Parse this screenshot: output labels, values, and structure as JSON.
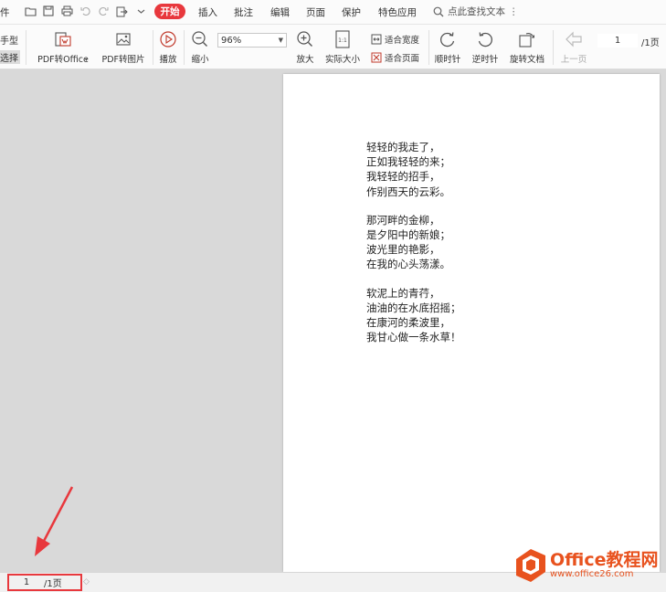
{
  "menubar": {
    "file_label": "件",
    "start_tab": "开始",
    "tabs": [
      "插入",
      "批注",
      "编辑",
      "页面",
      "保护",
      "特色应用"
    ],
    "search_placeholder": "点此查找文本"
  },
  "toolbar": {
    "left_cut_top": "手型",
    "left_cut_bottom": "选择",
    "pdf_to_office": "PDF转Office",
    "pdf_to_image": "PDF转图片",
    "play": "播放",
    "zoom_out": "缩小",
    "zoom_value": "96%",
    "zoom_in": "放大",
    "actual_size": "实际大小",
    "fit_width": "适合宽度",
    "fit_page": "适合页面",
    "rotate_cw": "顺时针",
    "rotate_ccw": "逆时针",
    "rotate_doc": "旋转文档",
    "prev_page": "上一页",
    "page_current": "1",
    "page_total": "/1页"
  },
  "document": {
    "stanzas": [
      [
        "轻轻的我走了，",
        "正如我轻轻的来；",
        "我轻轻的招手，",
        "作别西天的云彩。"
      ],
      [
        "那河畔的金柳，",
        "是夕阳中的新娘；",
        "波光里的艳影，",
        "在我的心头荡漾。"
      ],
      [
        "软泥上的青荇，",
        "油油的在水底招摇；",
        "在康河的柔波里，",
        "我甘心做一条水草！"
      ]
    ]
  },
  "statusbar": {
    "page_current": "1",
    "page_total": "/1页"
  },
  "watermark": {
    "title": "Office教程网",
    "url": "www.office26.com"
  },
  "colors": {
    "accent": "#e8383d",
    "annotation_arrow": "#e8383d",
    "logo_orange": "#e8521e"
  }
}
